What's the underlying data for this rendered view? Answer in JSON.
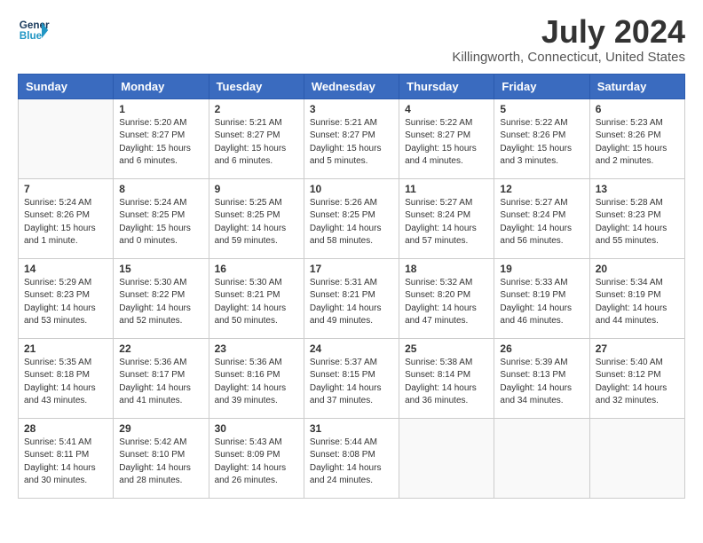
{
  "logo": {
    "line1": "General",
    "line2": "Blue"
  },
  "title": "July 2024",
  "location": "Killingworth, Connecticut, United States",
  "weekdays": [
    "Sunday",
    "Monday",
    "Tuesday",
    "Wednesday",
    "Thursday",
    "Friday",
    "Saturday"
  ],
  "weeks": [
    [
      {
        "day": "",
        "info": ""
      },
      {
        "day": "1",
        "info": "Sunrise: 5:20 AM\nSunset: 8:27 PM\nDaylight: 15 hours\nand 6 minutes."
      },
      {
        "day": "2",
        "info": "Sunrise: 5:21 AM\nSunset: 8:27 PM\nDaylight: 15 hours\nand 6 minutes."
      },
      {
        "day": "3",
        "info": "Sunrise: 5:21 AM\nSunset: 8:27 PM\nDaylight: 15 hours\nand 5 minutes."
      },
      {
        "day": "4",
        "info": "Sunrise: 5:22 AM\nSunset: 8:27 PM\nDaylight: 15 hours\nand 4 minutes."
      },
      {
        "day": "5",
        "info": "Sunrise: 5:22 AM\nSunset: 8:26 PM\nDaylight: 15 hours\nand 3 minutes."
      },
      {
        "day": "6",
        "info": "Sunrise: 5:23 AM\nSunset: 8:26 PM\nDaylight: 15 hours\nand 2 minutes."
      }
    ],
    [
      {
        "day": "7",
        "info": "Sunrise: 5:24 AM\nSunset: 8:26 PM\nDaylight: 15 hours\nand 1 minute."
      },
      {
        "day": "8",
        "info": "Sunrise: 5:24 AM\nSunset: 8:25 PM\nDaylight: 15 hours\nand 0 minutes."
      },
      {
        "day": "9",
        "info": "Sunrise: 5:25 AM\nSunset: 8:25 PM\nDaylight: 14 hours\nand 59 minutes."
      },
      {
        "day": "10",
        "info": "Sunrise: 5:26 AM\nSunset: 8:25 PM\nDaylight: 14 hours\nand 58 minutes."
      },
      {
        "day": "11",
        "info": "Sunrise: 5:27 AM\nSunset: 8:24 PM\nDaylight: 14 hours\nand 57 minutes."
      },
      {
        "day": "12",
        "info": "Sunrise: 5:27 AM\nSunset: 8:24 PM\nDaylight: 14 hours\nand 56 minutes."
      },
      {
        "day": "13",
        "info": "Sunrise: 5:28 AM\nSunset: 8:23 PM\nDaylight: 14 hours\nand 55 minutes."
      }
    ],
    [
      {
        "day": "14",
        "info": "Sunrise: 5:29 AM\nSunset: 8:23 PM\nDaylight: 14 hours\nand 53 minutes."
      },
      {
        "day": "15",
        "info": "Sunrise: 5:30 AM\nSunset: 8:22 PM\nDaylight: 14 hours\nand 52 minutes."
      },
      {
        "day": "16",
        "info": "Sunrise: 5:30 AM\nSunset: 8:21 PM\nDaylight: 14 hours\nand 50 minutes."
      },
      {
        "day": "17",
        "info": "Sunrise: 5:31 AM\nSunset: 8:21 PM\nDaylight: 14 hours\nand 49 minutes."
      },
      {
        "day": "18",
        "info": "Sunrise: 5:32 AM\nSunset: 8:20 PM\nDaylight: 14 hours\nand 47 minutes."
      },
      {
        "day": "19",
        "info": "Sunrise: 5:33 AM\nSunset: 8:19 PM\nDaylight: 14 hours\nand 46 minutes."
      },
      {
        "day": "20",
        "info": "Sunrise: 5:34 AM\nSunset: 8:19 PM\nDaylight: 14 hours\nand 44 minutes."
      }
    ],
    [
      {
        "day": "21",
        "info": "Sunrise: 5:35 AM\nSunset: 8:18 PM\nDaylight: 14 hours\nand 43 minutes."
      },
      {
        "day": "22",
        "info": "Sunrise: 5:36 AM\nSunset: 8:17 PM\nDaylight: 14 hours\nand 41 minutes."
      },
      {
        "day": "23",
        "info": "Sunrise: 5:36 AM\nSunset: 8:16 PM\nDaylight: 14 hours\nand 39 minutes."
      },
      {
        "day": "24",
        "info": "Sunrise: 5:37 AM\nSunset: 8:15 PM\nDaylight: 14 hours\nand 37 minutes."
      },
      {
        "day": "25",
        "info": "Sunrise: 5:38 AM\nSunset: 8:14 PM\nDaylight: 14 hours\nand 36 minutes."
      },
      {
        "day": "26",
        "info": "Sunrise: 5:39 AM\nSunset: 8:13 PM\nDaylight: 14 hours\nand 34 minutes."
      },
      {
        "day": "27",
        "info": "Sunrise: 5:40 AM\nSunset: 8:12 PM\nDaylight: 14 hours\nand 32 minutes."
      }
    ],
    [
      {
        "day": "28",
        "info": "Sunrise: 5:41 AM\nSunset: 8:11 PM\nDaylight: 14 hours\nand 30 minutes."
      },
      {
        "day": "29",
        "info": "Sunrise: 5:42 AM\nSunset: 8:10 PM\nDaylight: 14 hours\nand 28 minutes."
      },
      {
        "day": "30",
        "info": "Sunrise: 5:43 AM\nSunset: 8:09 PM\nDaylight: 14 hours\nand 26 minutes."
      },
      {
        "day": "31",
        "info": "Sunrise: 5:44 AM\nSunset: 8:08 PM\nDaylight: 14 hours\nand 24 minutes."
      },
      {
        "day": "",
        "info": ""
      },
      {
        "day": "",
        "info": ""
      },
      {
        "day": "",
        "info": ""
      }
    ]
  ]
}
